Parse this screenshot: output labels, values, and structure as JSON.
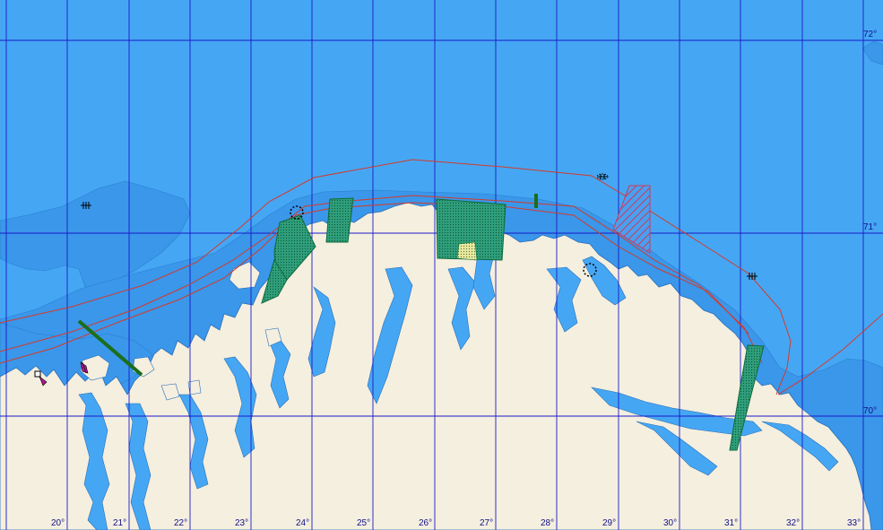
{
  "map": {
    "latitude_labels": [
      "72°",
      "71°",
      "70°"
    ],
    "longitude_labels": [
      "20°",
      "21°",
      "22°",
      "23°",
      "24°",
      "25°",
      "26°",
      "27°",
      "28°",
      "29°",
      "30°",
      "31°",
      "32°",
      "33°"
    ],
    "colors": {
      "deep_sea": "#45a7f4",
      "shallow_sea": "#3a97ea",
      "land": "#f5efdf",
      "graticule": "#1a1ac8",
      "boundary_line": "#d43a2a",
      "zone_fill": "#2f9e7c",
      "zone_outline": "#0d6b3a",
      "restricted_zone": "#d0385a",
      "cable_segment": "#1b6e1b"
    },
    "symbols": [
      "dashed-circle-icon",
      "dashed-circle-icon",
      "wreck-icon",
      "wreck-icon",
      "wreck-icon",
      "buoy-icon",
      "beacon-icon"
    ]
  }
}
